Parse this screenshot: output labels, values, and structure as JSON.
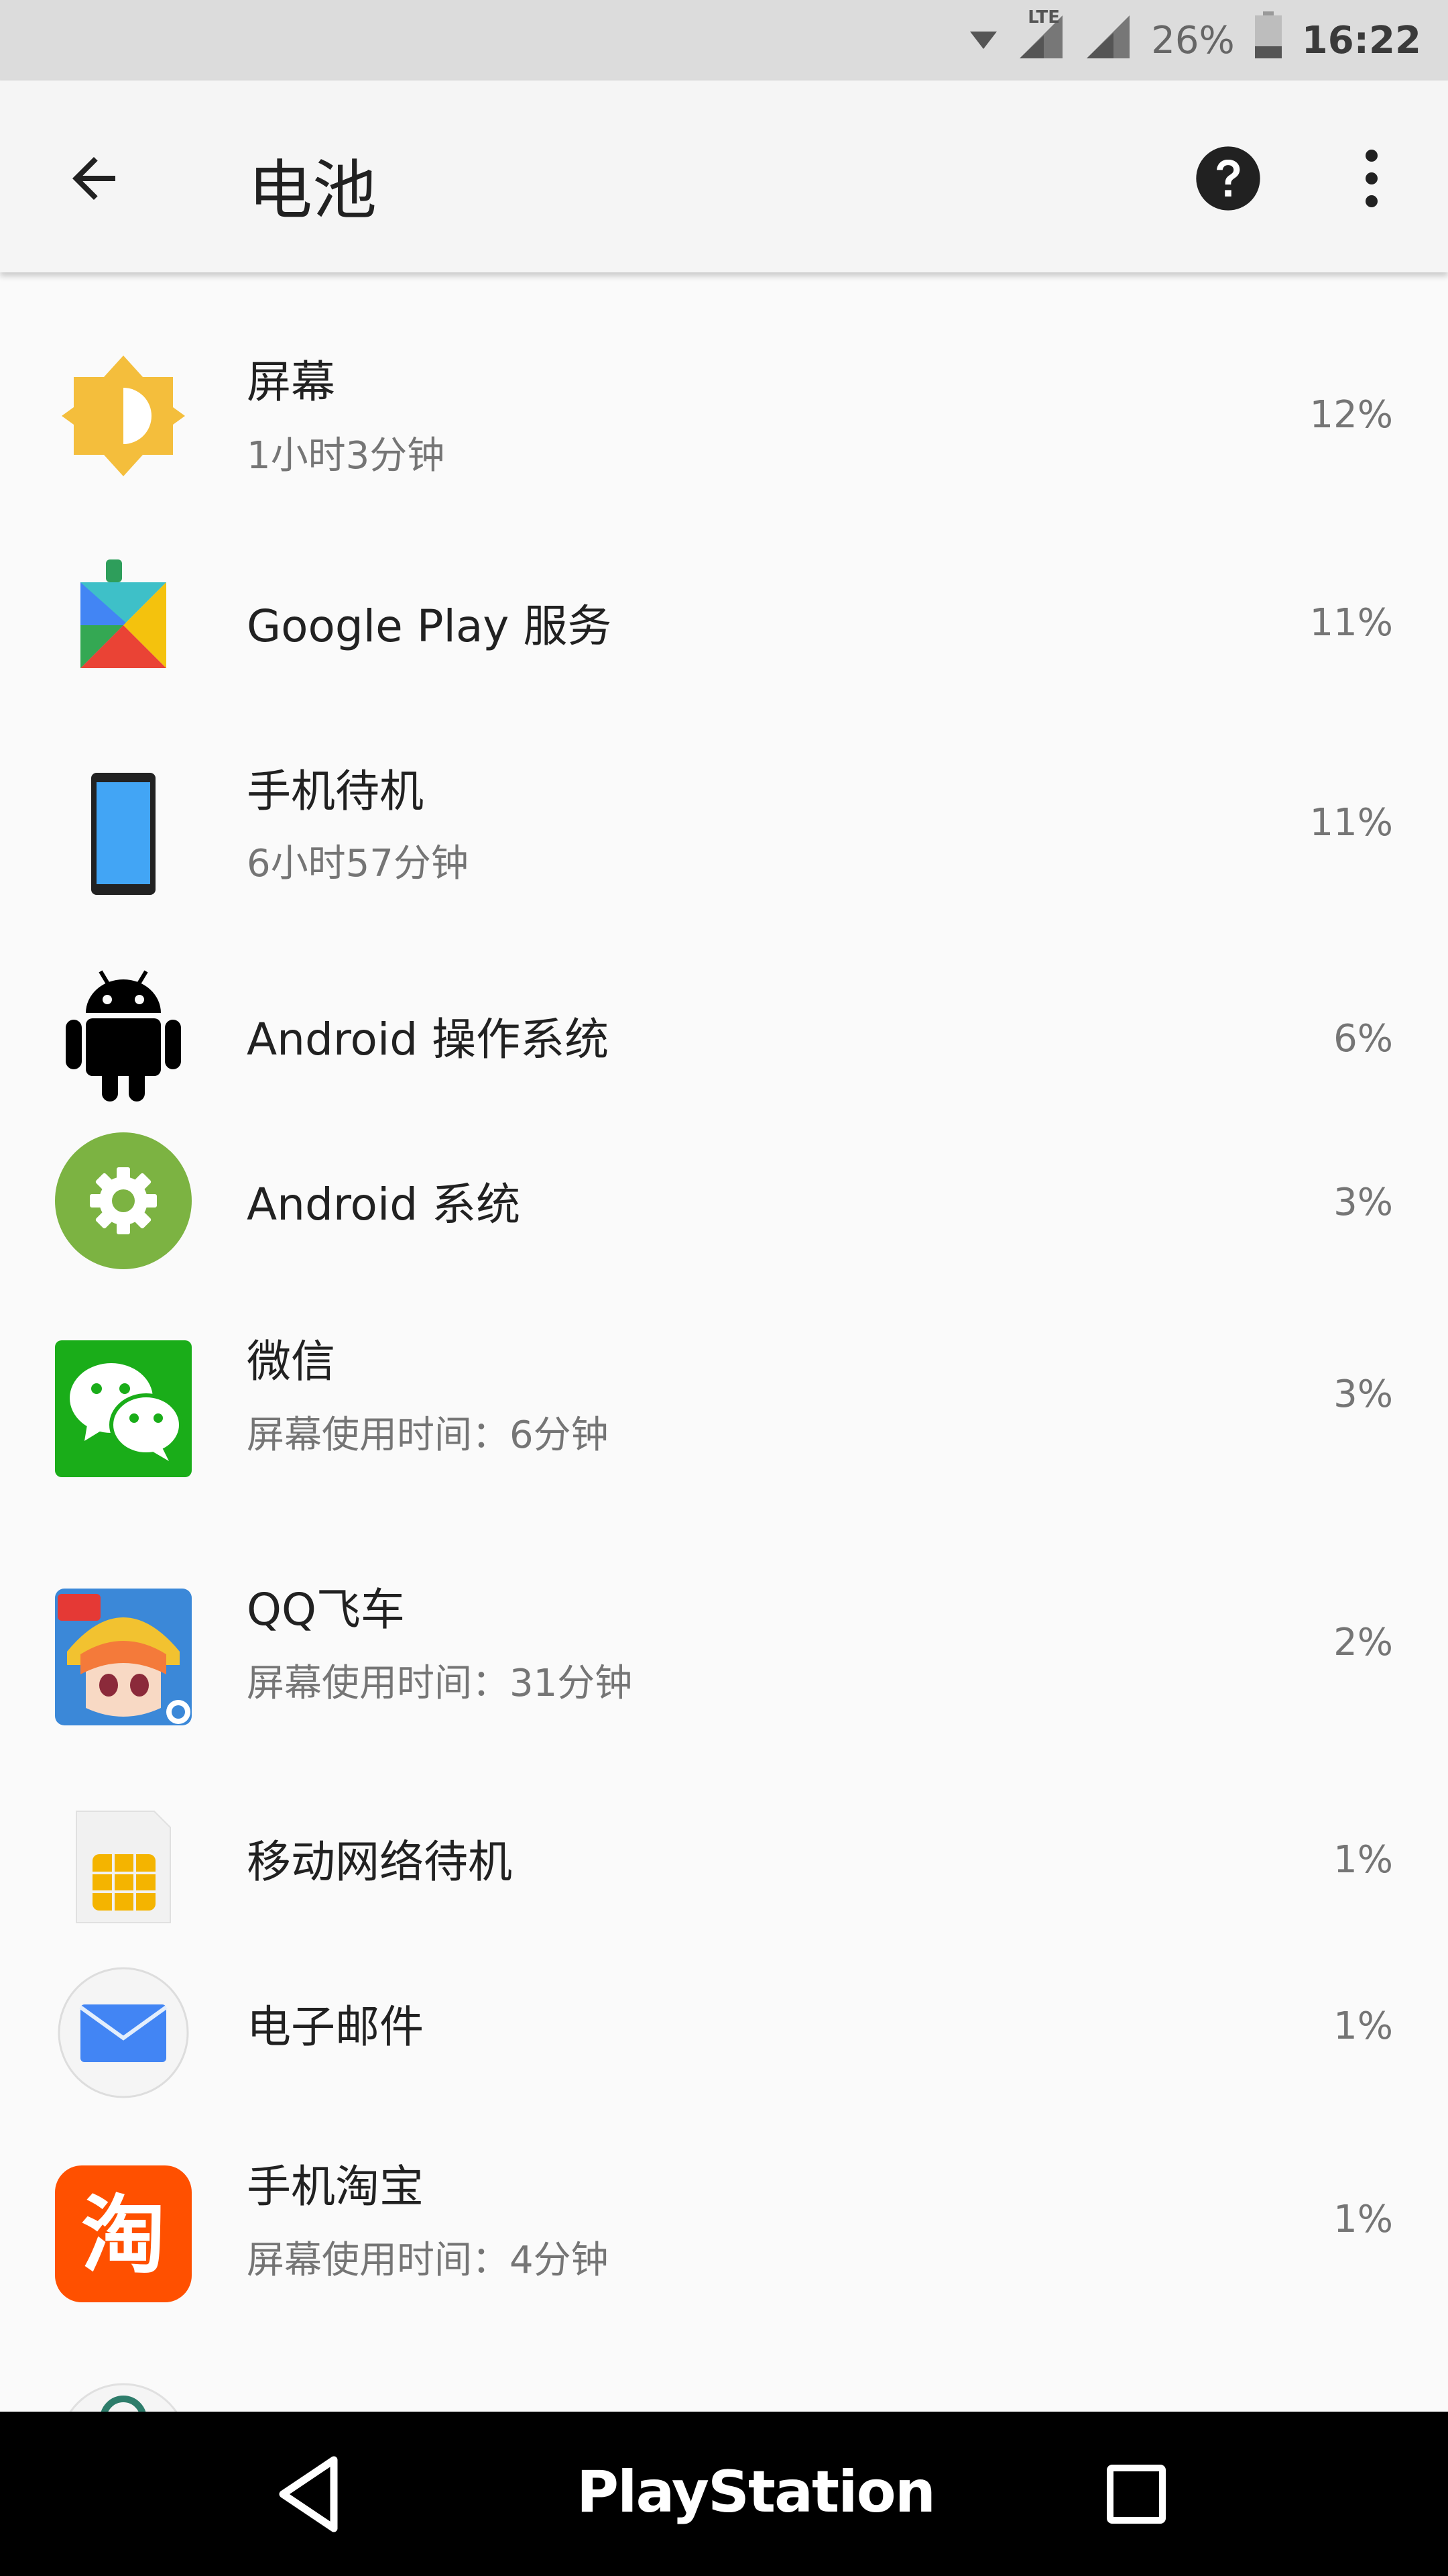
{
  "status_bar": {
    "network": "LTE",
    "battery_percent": "26%",
    "time": "16:22"
  },
  "app_bar": {
    "title": "电池",
    "back_icon": "arrow-left-icon",
    "help_icon": "help-circle-icon",
    "more_icon": "more-vert-icon"
  },
  "usage_list": [
    {
      "name": "屏幕",
      "sub": "1小时3分钟",
      "percent": "12%",
      "icon": "brightness-icon"
    },
    {
      "name": "Google Play 服务",
      "sub": "",
      "percent": "11%",
      "icon": "google-play-services-icon"
    },
    {
      "name": "手机待机",
      "sub": "6小时57分钟",
      "percent": "11%",
      "icon": "phone-idle-icon"
    },
    {
      "name": "Android 操作系统",
      "sub": "",
      "percent": "6%",
      "icon": "android-robot-icon"
    },
    {
      "name": "Android 系统",
      "sub": "",
      "percent": "3%",
      "icon": "android-system-gear-icon"
    },
    {
      "name": "微信",
      "sub": "屏幕使用时间：6分钟",
      "percent": "3%",
      "icon": "wechat-icon"
    },
    {
      "name": "QQ飞车",
      "sub": "屏幕使用时间：31分钟",
      "percent": "2%",
      "icon": "qq-speed-game-icon"
    },
    {
      "name": "移动网络待机",
      "sub": "",
      "percent": "1%",
      "icon": "sim-card-icon"
    },
    {
      "name": "电子邮件",
      "sub": "",
      "percent": "1%",
      "icon": "email-icon"
    },
    {
      "name": "手机淘宝",
      "sub": "屏幕使用时间：4分钟",
      "percent": "1%",
      "icon": "taobao-icon"
    }
  ],
  "nav_bar": {
    "home_label": "PlayStation",
    "back_icon": "nav-back-triangle-icon",
    "recents_icon": "nav-recents-square-icon"
  },
  "colors": {
    "status_bar_bg": "#dcdcdc",
    "app_bar_bg": "#f5f5f5",
    "page_bg": "#fafafa",
    "nav_bar_bg": "#000000"
  }
}
